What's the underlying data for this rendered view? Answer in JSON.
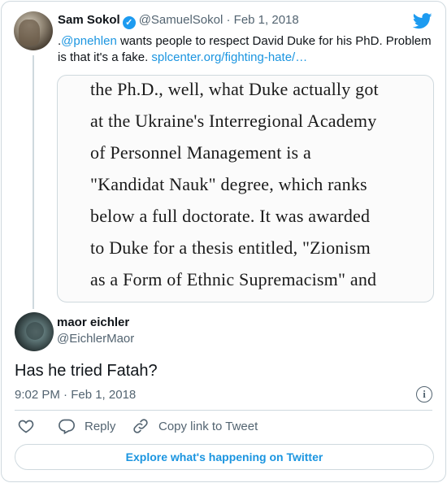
{
  "parent_tweet": {
    "author_name": "Sam Sokol",
    "verified_mark": "✓",
    "handle": "@SamuelSokol",
    "separator": "·",
    "date": "Feb 1, 2018",
    "text_prefix": ".",
    "mention": "@pnehlen",
    "text_body": " wants people to respect David Duke for his PhD. Problem is that it's a fake. ",
    "link": "splcenter.org/fighting-hate/…",
    "image_lines": [
      "the Ph.D., well, what Duke actually got",
      "at the Ukraine's Interregional Academy",
      "of Personnel Management is a",
      "\"Kandidat Nauk\" degree, which ranks",
      "below a full doctorate. It was awarded",
      "to Duke for a thesis entitled, \"Zionism",
      "as a Form of Ethnic Supremacism\" and"
    ]
  },
  "reply_tweet": {
    "author_name": "maor eichler",
    "handle": "@EichlerMaor",
    "text": "Has he tried Fatah?",
    "timestamp": "9:02 PM · Feb 1, 2018",
    "info_glyph": "i"
  },
  "actions": {
    "reply_label": "Reply",
    "copy_link_label": "Copy link to Tweet"
  },
  "explore_button_label": "Explore what's happening on Twitter",
  "colors": {
    "link": "#1b95e0",
    "verified": "#1d9bf0",
    "muted": "#536471",
    "border": "#cfd9de"
  },
  "icons": [
    "twitter-bird-icon",
    "verified-badge-icon",
    "info-icon",
    "heart-icon",
    "reply-icon",
    "link-icon"
  ]
}
